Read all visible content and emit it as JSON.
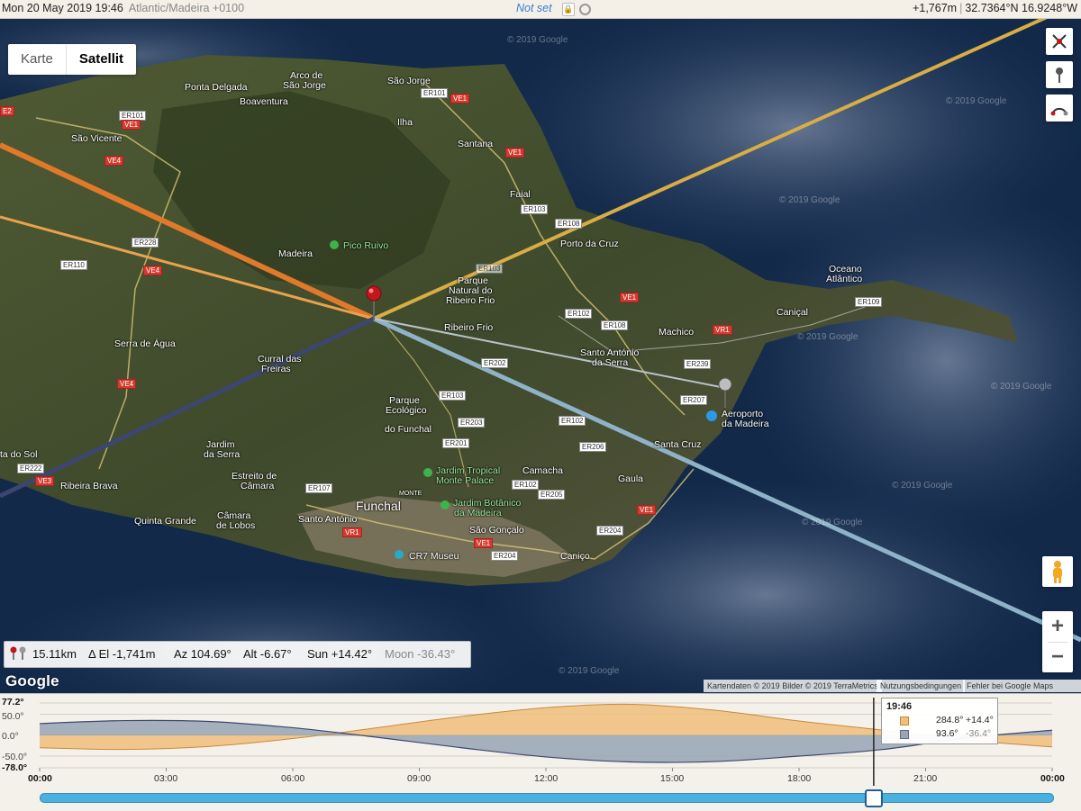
{
  "header": {
    "datetime": "Mon 20 May 2019 19:46",
    "timezone": "Atlantic/Madeira +0100",
    "status": "Not set",
    "elevation": "+1,767m",
    "coordinates": "32.7364°N 16.9248°W"
  },
  "map_type": {
    "options": [
      "Karte",
      "Satellit"
    ],
    "selected": "Satellit"
  },
  "places": {
    "ponta_delgada": "Ponta Delgada",
    "arco_de": "Arco de",
    "sao_jorge_arco": "São Jorge",
    "sao_jorge": "São Jorge",
    "boaventura": "Boaventura",
    "ilha": "Ilha",
    "sao_vicente": "São Vicente",
    "santana": "Santana",
    "faial": "Faial",
    "porto_da_cruz": "Porto da Cruz",
    "madeira": "Madeira",
    "pico_ruivo": "Pico Ruivo",
    "oceano": "Oceano",
    "atlantico": "Atlântico",
    "canical": "Caniçal",
    "parque_natural_1": "Parque",
    "parque_natural_2": "Natural do",
    "parque_natural_3": "Ribeiro Frio",
    "ribeiro_frio": "Ribeiro Frio",
    "machico": "Machico",
    "serra_de_agua": "Serra de Água",
    "curral": "Curral das",
    "freiras": "Freiras",
    "santo_antonio_serra_1": "Santo António",
    "santo_antonio_serra_2": "da Serra",
    "aeroporto_1": "Aeroporto",
    "aeroporto_2": "da Madeira",
    "parque_eco_1": "Parque",
    "parque_eco_2": "Ecológico",
    "parque_eco_3": "do Funchal",
    "santa_cruz": "Santa Cruz",
    "jardim_da_serra_1": "Jardim",
    "jardim_da_serra_2": "da Serra",
    "ponta_do_sol": "ta do Sol",
    "estreito_1": "Estreito de",
    "estreito_2": "Câmara",
    "jardim_tropical_1": "Jardim Tropical",
    "jardim_tropical_2": "Monte Palace",
    "camacha": "Camacha",
    "gaula": "Gaula",
    "ribeira_brava": "Ribeira Brava",
    "funchal": "Funchal",
    "monte": "MONTE",
    "jardim_botanico_1": "Jardim Botânico",
    "jardim_botanico_2": "da Madeira",
    "quinta_grande": "Quinta Grande",
    "camara_lobos_1": "Câmara",
    "camara_lobos_2": "de Lobos",
    "santo_antonio": "Santo António",
    "sao_goncalo": "São Gonçalo",
    "cr7_museu": "CR7 Museu",
    "canico": "Caniço"
  },
  "roads": {
    "e2": "E2",
    "er101_a": "ER101",
    "ve1_a": "VE1",
    "er101_b": "ER101",
    "ve1_b": "VE1",
    "ve4_a": "VE4",
    "ve1_c": "VE1",
    "er103_a": "ER103",
    "er108_a": "ER108",
    "er228": "ER228",
    "er110": "ER110",
    "ve4_b": "VE4",
    "er109": "ER109",
    "ve1_d": "VE1",
    "er102_a": "ER102",
    "er108_b": "ER108",
    "vr1_a": "VR1",
    "er202": "ER202",
    "er239": "ER239",
    "er103_b": "ER103",
    "ve4_c": "VE4",
    "er207": "ER207",
    "er203": "ER203",
    "er102_b": "ER102",
    "er201": "ER201",
    "er206": "ER206",
    "er222": "ER222",
    "ve3": "VE3",
    "er107": "ER107",
    "er102_c": "ER102",
    "er205": "ER205",
    "ve1_e": "VE1",
    "er204_a": "ER204",
    "vr1_b": "VR1",
    "ve1_f": "VE1",
    "er204_b": "ER204",
    "er103_c": "ER103"
  },
  "watermark": "© 2019 Google",
  "infobar": {
    "distance": "15.11km",
    "delta_el": "Δ El  -1,741m",
    "azimuth": "Az 104.69°",
    "altitude": "Alt  -6.67°",
    "sun": "Sun +14.42°",
    "moon": "Moon -36.43°"
  },
  "google_logo": "Google",
  "attribution": {
    "data": "Kartendaten © 2019 Bilder © 2019 TerraMetrics",
    "terms": "Nutzungsbedingungen",
    "report": "Fehler bei Google Maps melden"
  },
  "controls": {
    "zoom_in": "+",
    "zoom_out": "−"
  },
  "colors": {
    "sun_line": "#e07a2a",
    "sunset_line": "#eba24a",
    "sunrise_line": "#d9ad45",
    "moon_line": "#3c4670",
    "moonrise_line": "#8fb2c8",
    "sun_area": "#f0be7c",
    "moon_area": "#97a5b5"
  },
  "chart_data": {
    "type": "area",
    "y_labels": {
      "max": "77.2°",
      "upper": "50.0°",
      "zero": "0.0°",
      "lower": "-50.0°",
      "min": "-78.0°"
    },
    "ylim": [
      -78.0,
      77.2
    ],
    "x_labels": [
      "00:00",
      "03:00",
      "06:00",
      "09:00",
      "12:00",
      "15:00",
      "18:00",
      "21:00",
      "00:00"
    ],
    "series": [
      {
        "name": "Sun",
        "x_hours": [
          0,
          2,
          4,
          6,
          8,
          10,
          12,
          14,
          16,
          18,
          20,
          22,
          24
        ],
        "values": [
          -30,
          -34,
          -27,
          -8,
          18,
          45,
          66,
          74,
          60,
          34,
          12,
          -12,
          -28
        ]
      },
      {
        "name": "Moon",
        "x_hours": [
          0,
          2,
          4,
          6,
          8,
          10,
          12,
          14,
          16,
          18,
          20,
          22,
          24
        ],
        "values": [
          28,
          35,
          33,
          18,
          -5,
          -30,
          -52,
          -64,
          -63,
          -50,
          -34,
          -6,
          12
        ]
      }
    ],
    "cursor": {
      "time": "19:46",
      "time_hours": 19.77,
      "sun_azimuth": "284.8°",
      "sun_altitude": "+14.4°",
      "moon_azimuth": "93.6°",
      "moon_altitude": "-36.4°"
    }
  }
}
